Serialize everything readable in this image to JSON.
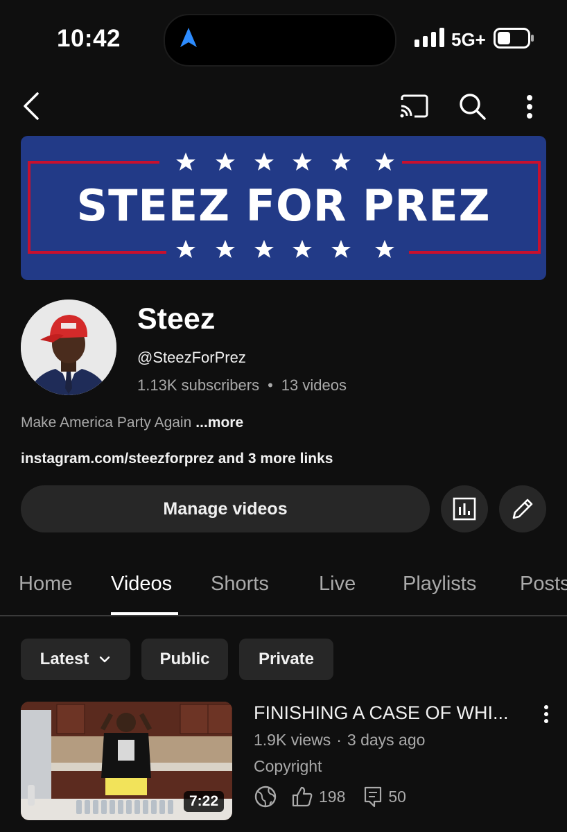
{
  "status_bar": {
    "time": "10:42",
    "network": "5G+"
  },
  "top_bar": {
    "icons": [
      "back-icon",
      "cast-icon",
      "search-icon",
      "more-vert-icon"
    ]
  },
  "banner": {
    "title": "STEEZ FOR PREZ",
    "colors": {
      "background": "#223a87",
      "stripe": "#c8102e",
      "stars": "#ffffff"
    }
  },
  "channel": {
    "name": "Steez",
    "handle": "@SteezForPrez",
    "subscribers": "1.13K subscribers",
    "separator": "•",
    "videos_count": "13 videos",
    "description": "Make America Party Again",
    "more_label": "...more",
    "links": "instagram.com/steezforprez and 3 more links"
  },
  "actions": {
    "manage_label": "Manage videos"
  },
  "tabs": [
    {
      "label": "Home",
      "active": false
    },
    {
      "label": "Videos",
      "active": true
    },
    {
      "label": "Shorts",
      "active": false
    },
    {
      "label": "Live",
      "active": false
    },
    {
      "label": "Playlists",
      "active": false
    },
    {
      "label": "Posts",
      "active": false
    }
  ],
  "filters": {
    "latest": "Latest",
    "public": "Public",
    "private": "Private"
  },
  "videos": [
    {
      "title": "FINISHING A CASE OF WHI...",
      "views": "1.9K views",
      "meta_separator": "·",
      "age": "3 days ago",
      "status": "Copyright",
      "duration": "7:22",
      "likes": "198",
      "comments": "50"
    }
  ]
}
